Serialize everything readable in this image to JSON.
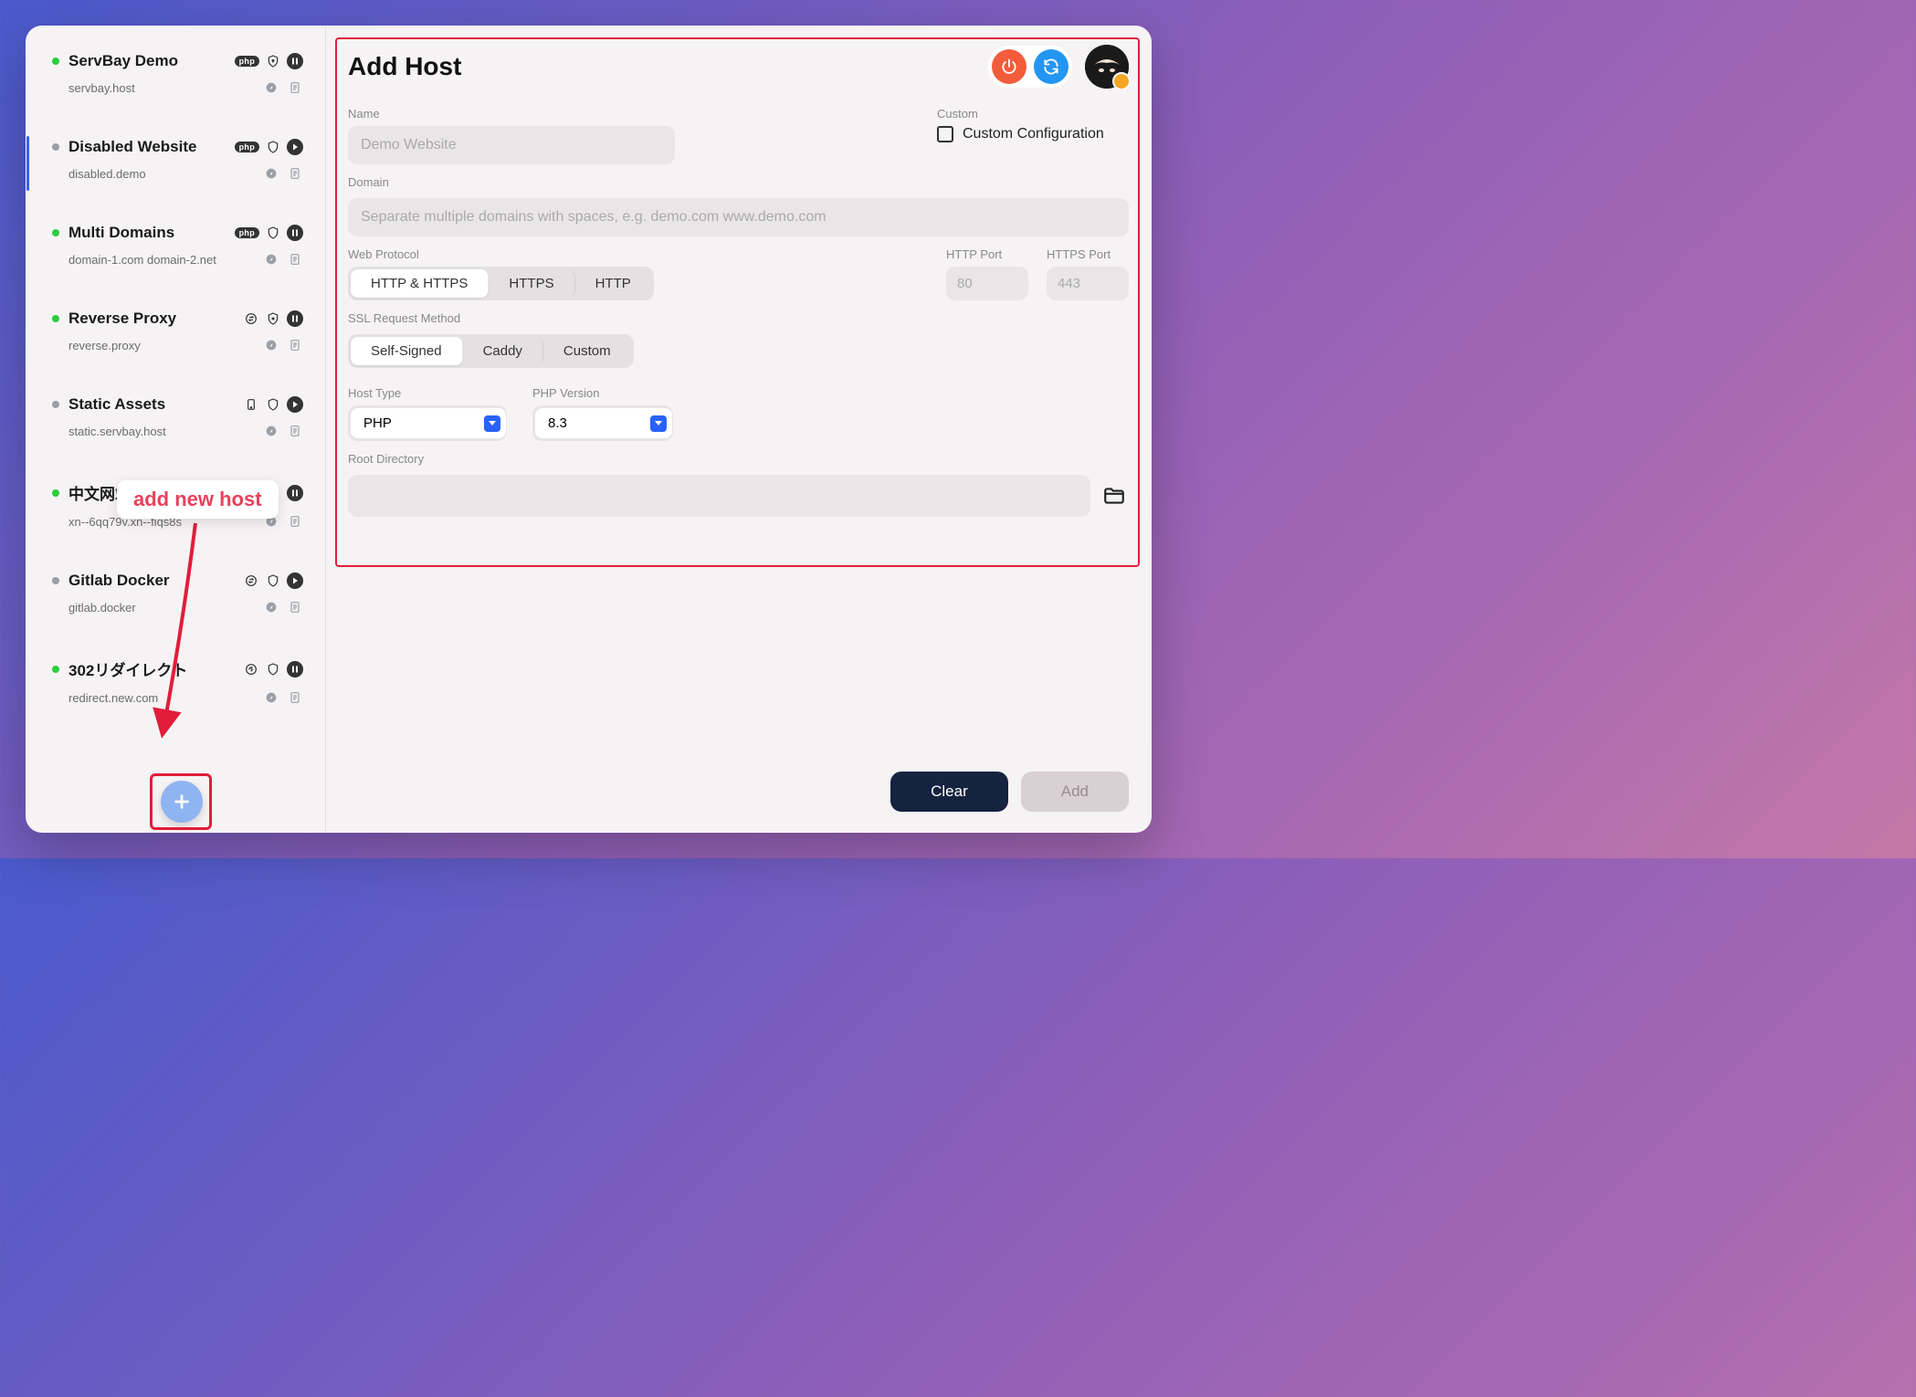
{
  "sidebar": {
    "hosts": [
      {
        "name": "ServBay Demo",
        "domain": "servbay.host",
        "status": "green",
        "icon1": "php",
        "icon2": "shield-lock",
        "icon3": "pause"
      },
      {
        "name": "Disabled Website",
        "domain": "disabled.demo",
        "status": "gray",
        "icon1": "php",
        "icon2": "shield",
        "icon3": "play",
        "selected": true
      },
      {
        "name": "Multi Domains",
        "domain": "domain-1.com domain-2.net",
        "status": "green",
        "icon1": "php",
        "icon2": "shield",
        "icon3": "pause"
      },
      {
        "name": "Reverse Proxy",
        "domain": "reverse.proxy",
        "status": "green",
        "icon1": "swap",
        "icon2": "shield-x",
        "icon3": "pause"
      },
      {
        "name": "Static Assets",
        "domain": "static.servbay.host",
        "status": "gray",
        "icon1": "device",
        "icon2": "shield",
        "icon3": "play"
      },
      {
        "name": "中文网站测试",
        "domain": "xn--6qq79v.xn--fiqs8s",
        "status": "green",
        "icon1": "php",
        "icon2": "shield",
        "icon3": "pause"
      },
      {
        "name": "Gitlab Docker",
        "domain": "gitlab.docker",
        "status": "gray",
        "icon1": "swap",
        "icon2": "shield",
        "icon3": "play"
      },
      {
        "name": "302リダイレクト",
        "domain": "redirect.new.com",
        "status": "green",
        "icon1": "redirect",
        "icon2": "shield",
        "icon3": "pause"
      }
    ]
  },
  "hint": "add new host",
  "main": {
    "title": "Add Host",
    "labels": {
      "name": "Name",
      "domain": "Domain",
      "custom": "Custom",
      "custom_config": "Custom Configuration",
      "web_protocol": "Web Protocol",
      "http_port": "HTTP Port",
      "https_port": "HTTPS Port",
      "ssl_method": "SSL Request Method",
      "host_type": "Host Type",
      "php_version": "PHP Version",
      "root_dir": "Root Directory"
    },
    "placeholders": {
      "name": "Demo Website",
      "domain": "Separate multiple domains with spaces, e.g. demo.com www.demo.com",
      "http_port": "80",
      "https_port": "443"
    },
    "protocols": [
      "HTTP & HTTPS",
      "HTTPS",
      "HTTP"
    ],
    "ssl_methods": [
      "Self-Signed",
      "Caddy",
      "Custom"
    ],
    "host_type_value": "PHP",
    "php_version_value": "8.3"
  },
  "footer": {
    "clear": "Clear",
    "add": "Add"
  }
}
